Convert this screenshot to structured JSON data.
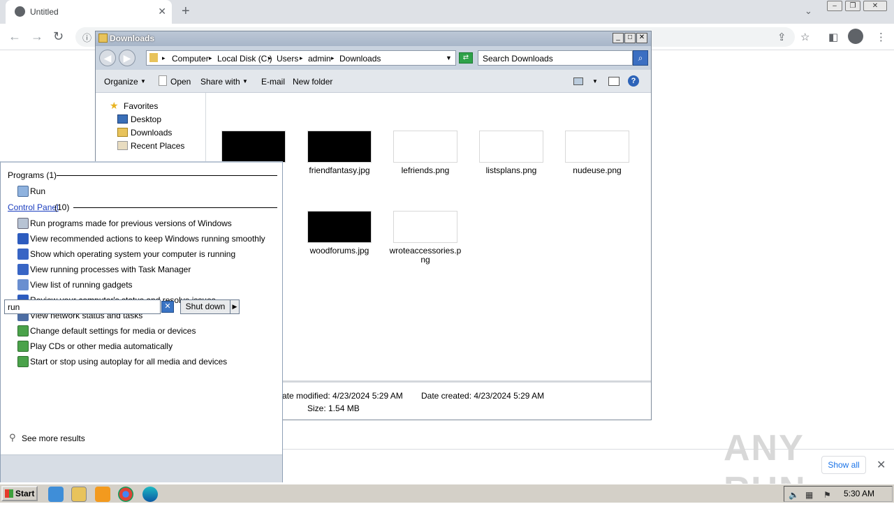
{
  "browser": {
    "tab_title": "Untitled",
    "tab_close": "✕",
    "new_tab": "+",
    "show_all": "Show all",
    "watermark": "ANY RUN"
  },
  "explorer": {
    "title": "Downloads",
    "breadcrumbs": [
      "Computer",
      "Local Disk (C:)",
      "Users",
      "admin",
      "Downloads"
    ],
    "search_placeholder": "Search Downloads",
    "commands": {
      "organize": "Organize",
      "open": "Open",
      "share_with": "Share with",
      "email": "E-mail",
      "new_folder": "New folder"
    },
    "nav": {
      "favorites": "Favorites",
      "desktop": "Desktop",
      "downloads": "Downloads",
      "recent_places": "Recent Places"
    },
    "files": [
      {
        "name": "friendfantasy.jpg",
        "dark": true
      },
      {
        "name": "lefriends.png",
        "dark": false
      },
      {
        "name": "listsplans.png",
        "dark": false
      },
      {
        "name": "nudeuse.png",
        "dark": false
      },
      {
        "name": "woodforums.jpg",
        "dark": true
      },
      {
        "name": "wroteaccessories.png",
        "dark": false
      }
    ],
    "details": {
      "date_modified": "ate modified:  4/23/2024 5:29 AM",
      "date_created": "Date created:  4/23/2024 5:29 AM",
      "size": "Size:  1.54 MB"
    }
  },
  "start_menu": {
    "programs_header": "Programs (1)",
    "programs": [
      "Run"
    ],
    "control_panel_link": "Control Panel",
    "control_panel_count": "(10)",
    "control_panel_items": [
      "Run programs made for previous versions of Windows",
      "View recommended actions to keep Windows running smoothly",
      "Show which operating system your computer is running",
      "View running processes with Task Manager",
      "View list of running gadgets",
      "Review your computer's status and resolve issues",
      "View network status and tasks",
      "Change default settings for media or devices",
      "Play CDs or other media automatically",
      "Start or stop using autoplay for all media and devices"
    ],
    "see_more": "See more results",
    "search_value": "run",
    "shutdown": "Shut down"
  },
  "taskbar": {
    "start": "Start",
    "clock": "5:30 AM"
  }
}
